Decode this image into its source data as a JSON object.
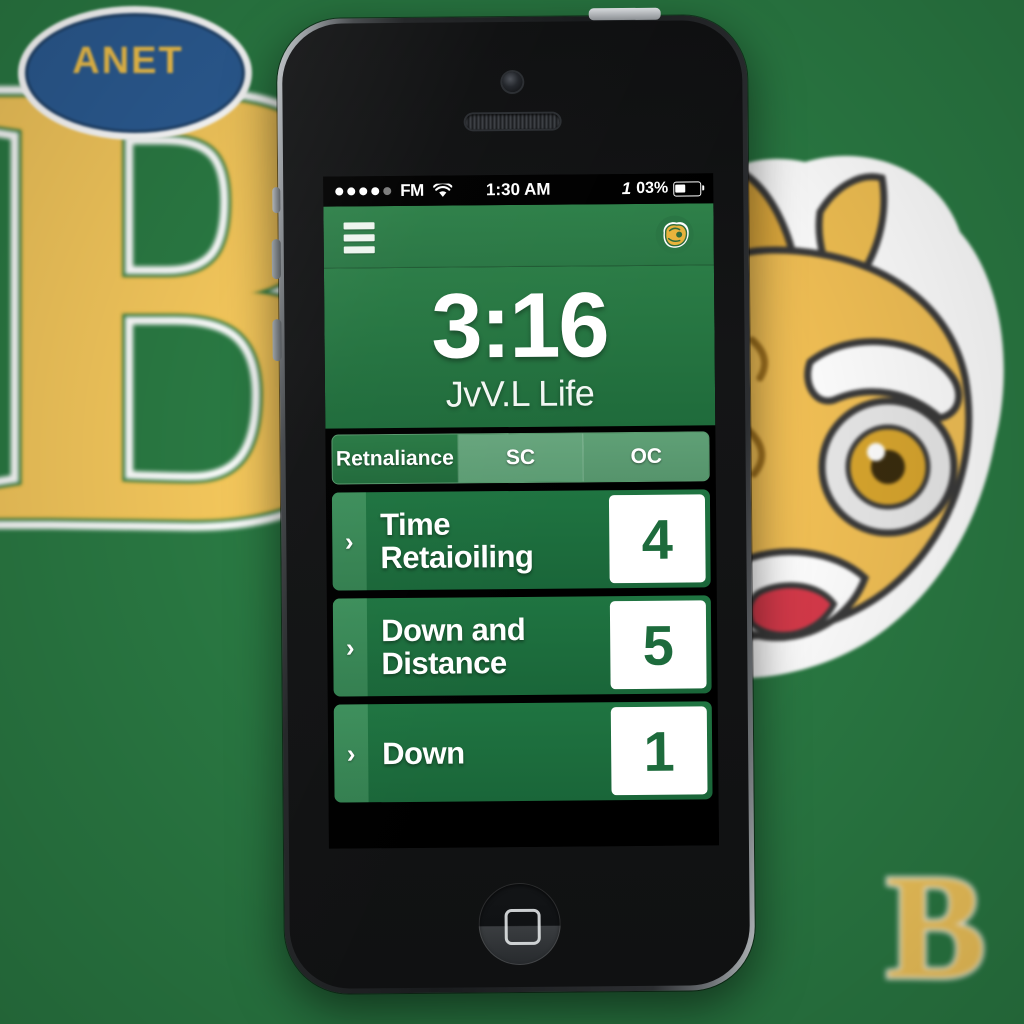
{
  "background": {
    "color": "#2a7a43",
    "team_letter": "B",
    "team_letter_small": "B",
    "badge_text": "ANET",
    "mascot_name": "wildcat-head"
  },
  "phone": {
    "model": "iphone",
    "hardware": {
      "camera": "front-camera",
      "earpiece": "earpiece-speaker",
      "power_button": "power-button",
      "volume_up": "volume-up-button",
      "volume_down": "volume-down-button",
      "silent_switch": "silent-switch",
      "home_button": "home-button"
    }
  },
  "status_bar": {
    "signal_dots_total": 5,
    "signal_dots_filled": 4,
    "carrier": "FM",
    "wifi": "wifi-icon",
    "time": "1:30 AM",
    "charging_indicator": "1",
    "battery_percent": "03%",
    "battery_fill_pct": 42
  },
  "nav_bar": {
    "menu_label": "menu",
    "logo_label": "team-logo"
  },
  "hero": {
    "clock": "3:16",
    "subtitle": "JvV.L Life"
  },
  "segmented_control": {
    "segments": [
      {
        "label": "Retnaliance",
        "selected": true
      },
      {
        "label": "SC",
        "selected": false
      },
      {
        "label": "OC",
        "selected": false
      }
    ]
  },
  "list": {
    "rows": [
      {
        "label": "Time Retaioiling",
        "value": "4",
        "chevron": "›"
      },
      {
        "label": "Down and Distance",
        "value": "5",
        "chevron": "›"
      },
      {
        "label": "Down",
        "value": "1",
        "chevron": "›"
      }
    ]
  },
  "colors": {
    "brand_green": "#2a7a43",
    "row_green": "#1f7441",
    "value_text": "#1d6b3c",
    "gold": "#f5c85c",
    "badge_blue": "#2b5b92"
  }
}
